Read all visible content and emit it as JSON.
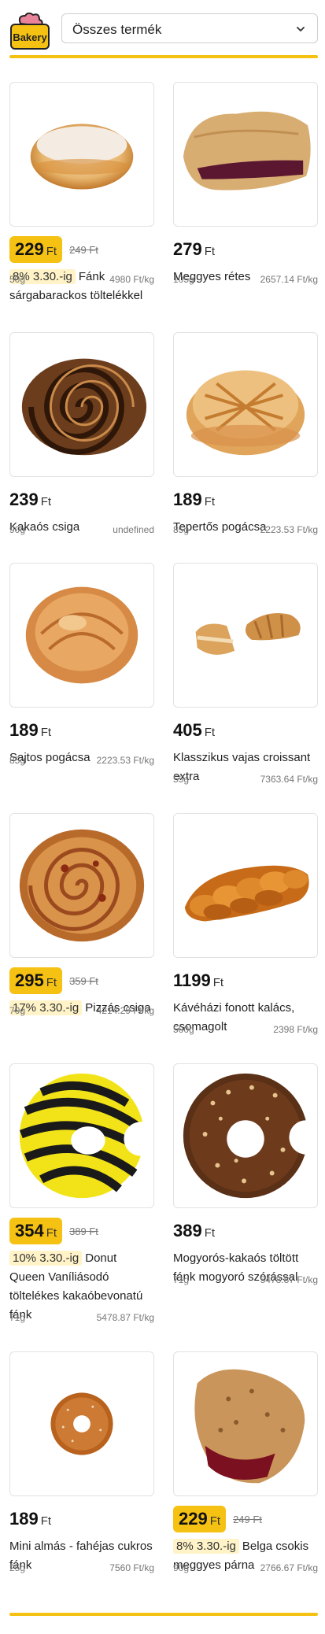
{
  "header": {
    "logo_text": "Bakery",
    "category_select": "Összes termék"
  },
  "colors": {
    "accent": "#f5c113",
    "promo_bg": "#fff3c7"
  },
  "products": [
    {
      "price": "229",
      "currency": "Ft",
      "old_price": "249 Ft",
      "promo": "8% 3.30.-ig",
      "name": "Fánk sárgabarackos töltelékkel",
      "weight": "50g",
      "unit_price": "4980 Ft/kg",
      "image": "donut-powdered"
    },
    {
      "price": "279",
      "currency": "Ft",
      "old_price": "",
      "promo": "",
      "name": "Meggyes rétes",
      "weight": "105g",
      "unit_price": "2657.14 Ft/kg",
      "image": "cherry-strudel"
    },
    {
      "price": "239",
      "currency": "Ft",
      "old_price": "",
      "promo": "",
      "name": "Kakaós csiga",
      "weight": "90g",
      "unit_price": "undefined",
      "image": "cocoa-roll"
    },
    {
      "price": "189",
      "currency": "Ft",
      "old_price": "",
      "promo": "",
      "name": "Tepertős pogácsa",
      "weight": "85g",
      "unit_price": "2223.53 Ft/kg",
      "image": "scone"
    },
    {
      "price": "189",
      "currency": "Ft",
      "old_price": "",
      "promo": "",
      "name": "Sajtos pogácsa",
      "weight": "85g",
      "unit_price": "2223.53 Ft/kg",
      "image": "cheese-scone"
    },
    {
      "price": "405",
      "currency": "Ft",
      "old_price": "",
      "promo": "",
      "name": "Klasszikus vajas croissant extra",
      "weight": "55g",
      "unit_price": "7363.64 Ft/kg",
      "image": "croissant"
    },
    {
      "price": "295",
      "currency": "Ft",
      "old_price": "359 Ft",
      "promo": "17% 3.30.-ig",
      "name": "Pizzás csiga",
      "weight": "70g",
      "unit_price": "4214.29 Ft/kg",
      "image": "pizza-roll"
    },
    {
      "price": "1199",
      "currency": "Ft",
      "old_price": "",
      "promo": "",
      "name": "Kávéházi fonott kalács, csomagolt",
      "weight": "500g",
      "unit_price": "2398 Ft/kg",
      "image": "braided-bread"
    },
    {
      "price": "354",
      "currency": "Ft",
      "old_price": "389 Ft",
      "promo": "10% 3.30.-ig",
      "name": "Donut Queen Vaníliásodó töltelékes kakaóbevonatú fánk",
      "weight": "71g",
      "unit_price": "5478.87 Ft/kg",
      "image": "striped-donut"
    },
    {
      "price": "389",
      "currency": "Ft",
      "old_price": "",
      "promo": "",
      "name": "Mogyorós-kakaós töltött fánk mogyoró szórással",
      "weight": "71g",
      "unit_price": "5478.87 Ft/kg",
      "image": "hazelnut-donut"
    },
    {
      "price": "189",
      "currency": "Ft",
      "old_price": "",
      "promo": "",
      "name": "Mini almás - fahéjas cukros fánk",
      "weight": "25g",
      "unit_price": "7560 Ft/kg",
      "image": "mini-donut"
    },
    {
      "price": "229",
      "currency": "Ft",
      "old_price": "249 Ft",
      "promo": "8% 3.30.-ig",
      "name": "Belga csokis meggyes párna",
      "weight": "90g",
      "unit_price": "2766.67 Ft/kg",
      "image": "cherry-pillow"
    }
  ]
}
